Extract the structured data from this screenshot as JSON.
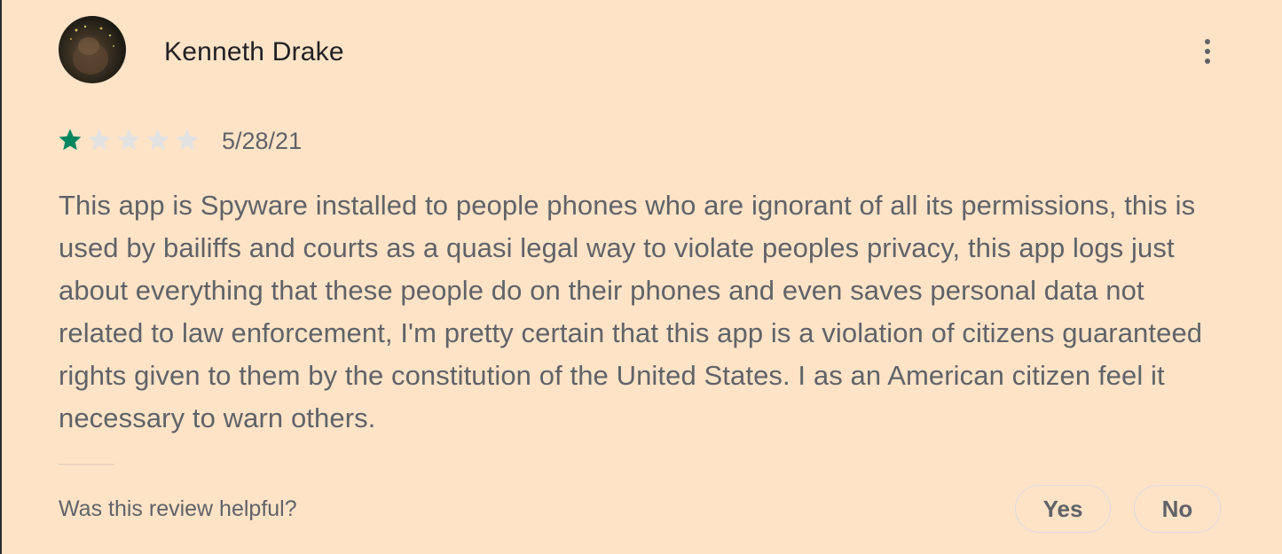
{
  "review": {
    "reviewer_name": "Kenneth Drake",
    "rating": {
      "value": 1,
      "max": 5,
      "filled_color": "#01875f",
      "empty_color": "#e2e2e2"
    },
    "date": "5/28/21",
    "text": "This app is Spyware installed to people phones who are ignorant of all its permissions, this is used by bailiffs and courts as a quasi legal way to violate peoples privacy, this app logs just about everything that these people do on their phones and even saves personal data not related to law enforcement, I'm pretty certain that this app is a violation of citizens guaranteed rights given to them by the constitution of the United States. I as an American citizen feel it necessary to warn others.",
    "menu_icon": "more-vert-icon"
  },
  "feedback": {
    "prompt": "Was this review helpful?",
    "yes_label": "Yes",
    "no_label": "No"
  },
  "colors": {
    "background": "#FFE3C7",
    "name_text": "#202124",
    "body_text": "#5f6368"
  }
}
